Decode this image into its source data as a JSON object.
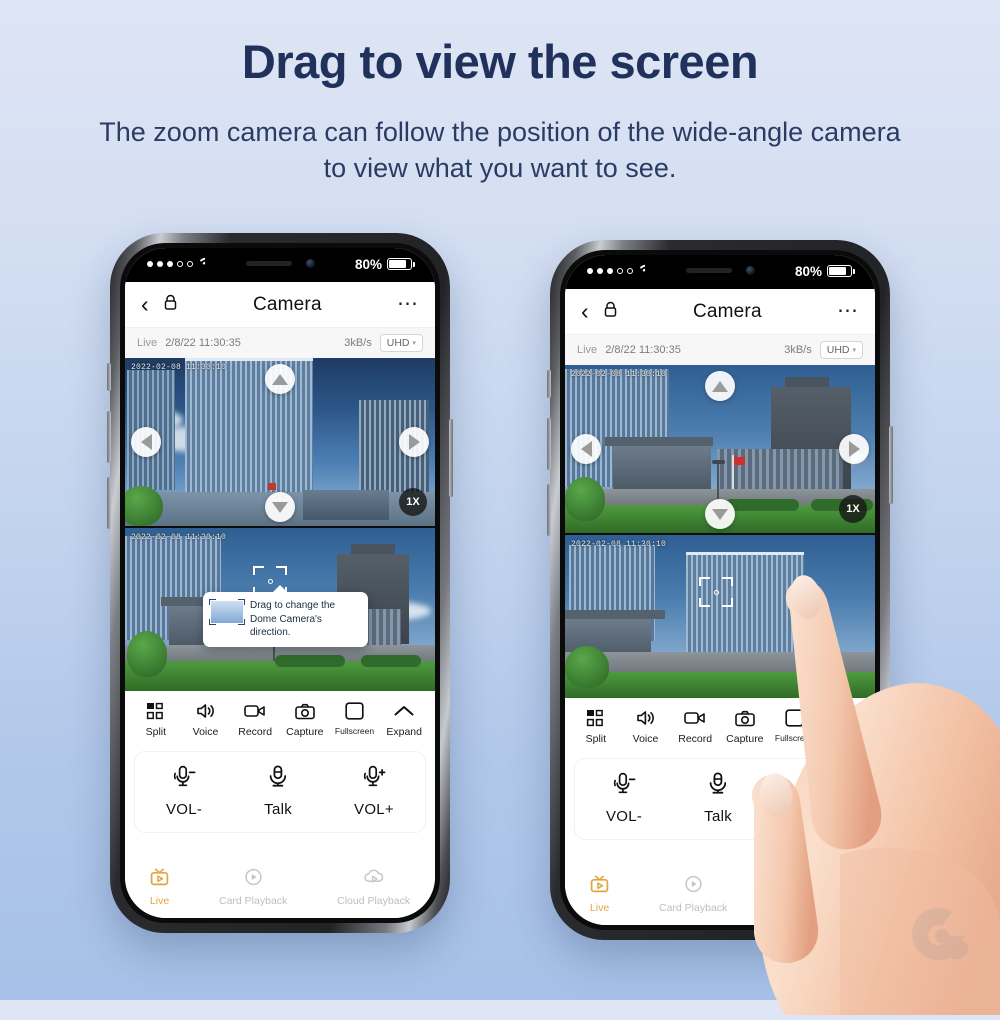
{
  "page": {
    "headline": "Drag to view the screen",
    "subline": "The zoom camera can follow the position of the wide-angle camera to view what you want to see.",
    "background_top": "#dee5f5",
    "background_bottom": "#a6c0e7",
    "headline_color": "#20325c"
  },
  "status_bar": {
    "signal_dots_filled": 3,
    "signal_dots_total": 5,
    "wifi_icon": "wifi-icon",
    "battery_percent": "80%",
    "battery_icon": "battery-icon"
  },
  "app_bar": {
    "back_icon": "chevron-left-icon",
    "lock_icon": "lock-icon",
    "title": "Camera",
    "more_icon": "more-horizontal-icon"
  },
  "info_bar": {
    "live_label": "Live",
    "timestamp": "2/8/22 11:30:35",
    "bitrate": "3kB/s",
    "quality": "UHD",
    "quality_caret": "▾"
  },
  "video": {
    "overlay_timestamp": "2022-02-08 11:30:10",
    "zoom_level": "1X",
    "arrows": {
      "up": "arrow-up",
      "down": "arrow-down",
      "left": "arrow-left",
      "right": "arrow-right"
    },
    "focus_icon": "focus-bracket-icon"
  },
  "tooltip": {
    "text": "Drag to change the Dome Camera's direction."
  },
  "toolbar": {
    "items": [
      {
        "label": "Split",
        "icon": "split-view-icon"
      },
      {
        "label": "Voice",
        "icon": "speaker-icon"
      },
      {
        "label": "Record",
        "icon": "video-camera-icon"
      },
      {
        "label": "Capture",
        "icon": "camera-icon"
      },
      {
        "label": "Fullscreen",
        "icon": "fullscreen-icon"
      },
      {
        "label": "Expand",
        "icon": "chevron-up-icon"
      }
    ]
  },
  "talk_panel": {
    "items": [
      {
        "label": "VOL-",
        "icon": "volume-down-mic-icon"
      },
      {
        "label": "Talk",
        "icon": "microphone-icon"
      },
      {
        "label": "VOL+",
        "icon": "volume-up-mic-icon"
      }
    ]
  },
  "tab_bar": {
    "items": [
      {
        "label": "Live",
        "icon": "live-tv-icon",
        "active": true
      },
      {
        "label": "Card Playback",
        "icon": "sd-playback-icon",
        "active": false
      },
      {
        "label": "Cloud Playback",
        "icon": "cloud-playback-icon",
        "active": false
      }
    ],
    "active_color": "#e2a53f",
    "inactive_color": "#b9bec6"
  },
  "hand": {
    "present": true,
    "name": "hand-pointing-finger"
  },
  "watermark": {
    "name": "brand-watermark"
  }
}
